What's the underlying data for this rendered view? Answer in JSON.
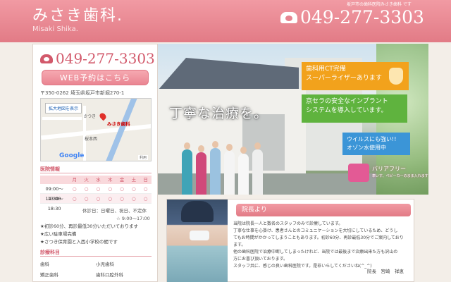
{
  "header": {
    "logo_ja": "みさき歯科.",
    "logo_en": "Misaki Shika.",
    "tagline": "坂戸市の歯科医院みさき歯科 です",
    "phone": "049-277-3303"
  },
  "sidebar": {
    "phone": "049-277-3303",
    "web_button": "WEB予約はこちら",
    "address": "〒350-0262 埼玉県坂戸市新堀270-1",
    "map": {
      "enlarge_link": "拡大地図を表示",
      "pin_label": "みさき歯科",
      "label_top": "さつき",
      "label_mid": "桜本西",
      "google": "Google",
      "terms": "利用"
    },
    "hours_title": "医院情報",
    "hours_header": [
      "",
      "月",
      "火",
      "水",
      "木",
      "金",
      "土",
      "日"
    ],
    "hours_rows": [
      [
        "09:00～13:00",
        "○",
        "○",
        "○",
        "○",
        "○",
        "○",
        "○"
      ],
      [
        "14:30～18:30",
        "○",
        "○",
        "○",
        "○",
        "○",
        "○",
        "○"
      ]
    ],
    "closed_line1": "休診日：日曜日、祝日、不定休",
    "closed_line2": "☆ 9:00～17:00",
    "notes": [
      "★初診60分、再診最低30分いただいております",
      "★広い駐車場完備",
      "★さつき保育園と入西小学校の間です"
    ],
    "subjects_title": "診療科目",
    "subjects": [
      "歯科",
      "小児歯科",
      "矯正歯科",
      "歯科口腔外科"
    ]
  },
  "hero": {
    "catch": "丁寧な治療を。",
    "badge_ct": [
      "歯科用CT完備",
      "スーパーライザーあります"
    ],
    "badge_implant": [
      "京セラの安全なインプラント",
      "システムを導入しています。"
    ],
    "badge_ozone": [
      "ウイルスにも強い!!",
      "オゾン水使用中"
    ],
    "barrier_free": "バリアフリー",
    "barrier_free_sub": "車いす、ベビーカーのまま入れます"
  },
  "director": {
    "title": "院長より",
    "paragraphs": [
      "当院は院長一人と数名のスタッフのみで診療しています。",
      "丁寧な仕事を心掛け、患者さんとのコミュニケーションを大切にしているため、どうし",
      "てもお時間がかかってしまうこともあります。初診60分、再診最低30分でご案内しており",
      "ます。",
      "他の歯科医院で治療中断してしまったけれど、当院では最後まで治療出来た方も沢山の",
      "方にお喜び頂いております。",
      "スタッフ共に、感じの良い歯科医院です。是非いらしてくださいね(^_^)"
    ],
    "signature": "院長　宮崎　祥恵"
  },
  "colors": {
    "accent": "#e27b86",
    "ct": "#f2a21c",
    "implant": "#5fb33e",
    "ozone": "#3b95d7",
    "barrier_free": "#e35a95"
  }
}
